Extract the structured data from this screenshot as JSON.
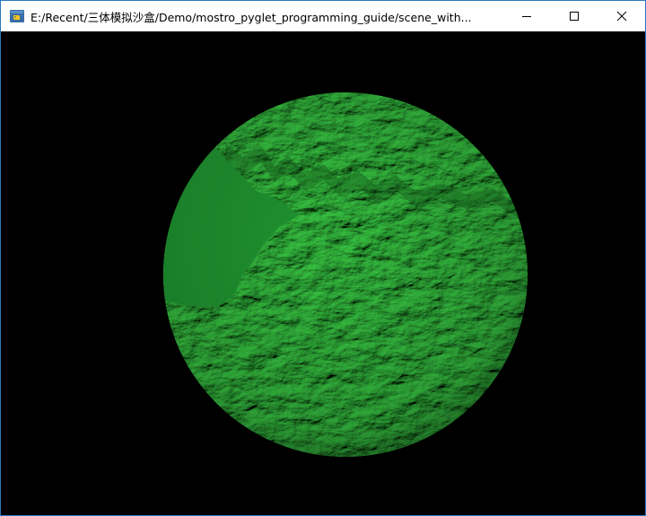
{
  "window": {
    "title": "E:/Recent/三体模拟沙盒/Demo/mostro_pyglet_programming_guide/scene_with..."
  },
  "icons": {
    "app": "python-icon",
    "minimize": "minimize-icon",
    "maximize": "maximize-icon",
    "close": "close-icon"
  },
  "colors": {
    "accent_border": "#2b79c2",
    "background": "#000000",
    "sphere_green": "#22922c"
  }
}
